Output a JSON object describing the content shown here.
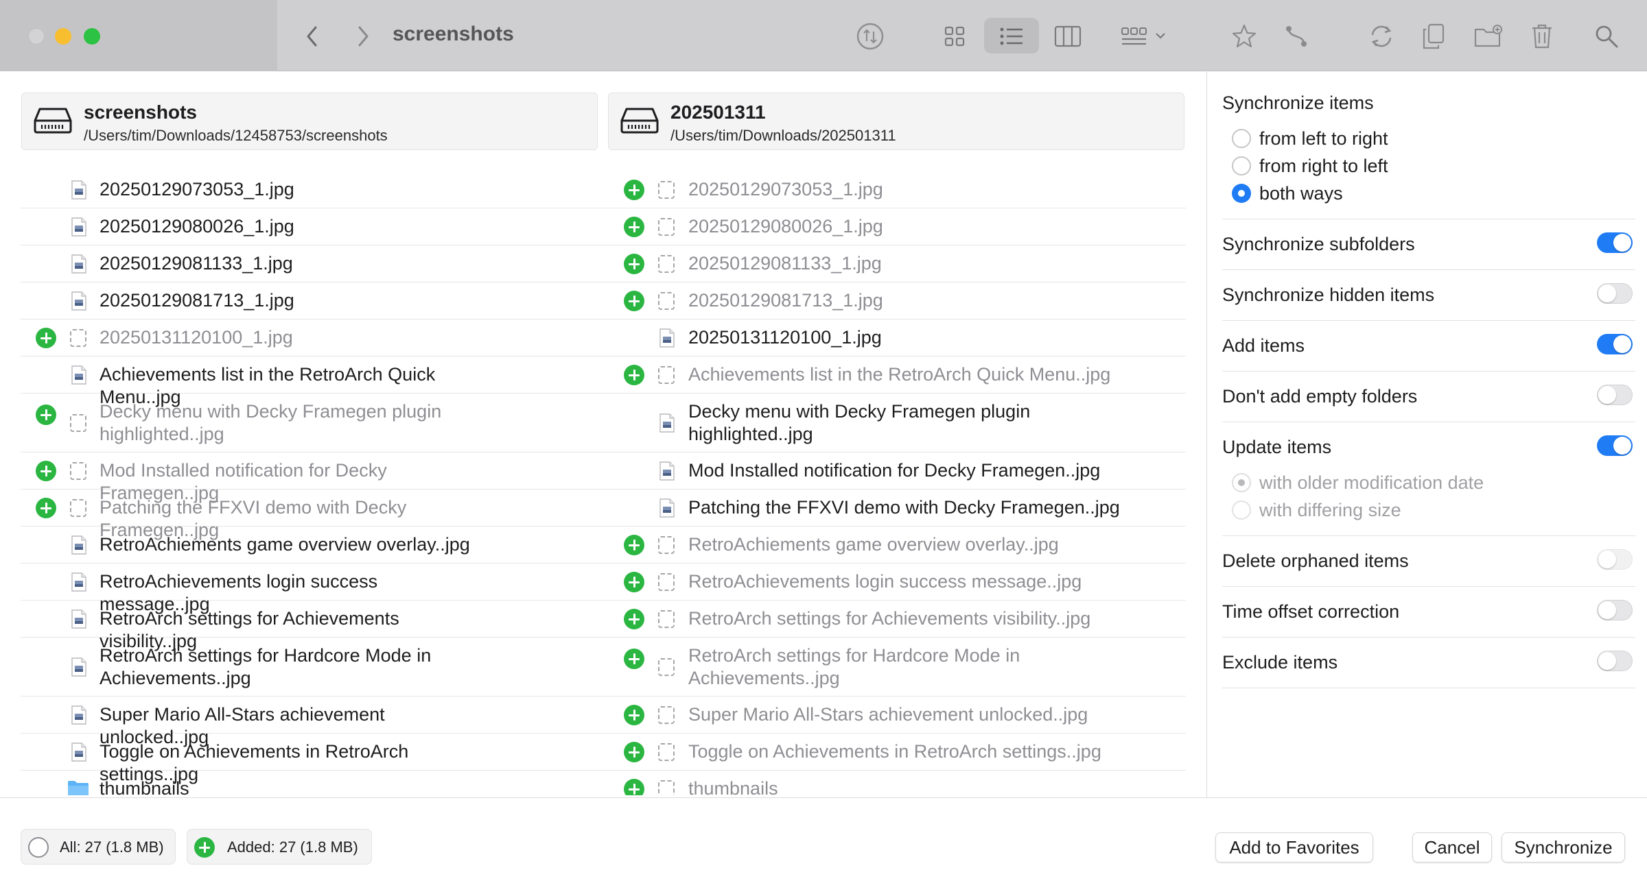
{
  "window": {
    "title": "screenshots",
    "toolbar_icons": [
      "back-icon",
      "forward-icon",
      "share-icon",
      "grid-view-icon",
      "list-view-icon",
      "column-view-icon",
      "group-by-icon",
      "star-icon",
      "connect-icon",
      "sync-icon",
      "copy-icon",
      "new-folder-icon",
      "trash-icon",
      "search-icon"
    ]
  },
  "left_panel": {
    "name": "screenshots",
    "path": "/Users/tim/Downloads/12458753/screenshots"
  },
  "right_panel": {
    "name": "202501311",
    "path": "/Users/tim/Downloads/202501311"
  },
  "files": [
    {
      "left": "20250129073053_1.jpg",
      "right": "20250129073053_1.jpg",
      "missing": "right",
      "type": "file"
    },
    {
      "left": "20250129080026_1.jpg",
      "right": "20250129080026_1.jpg",
      "missing": "right",
      "type": "file"
    },
    {
      "left": "20250129081133_1.jpg",
      "right": "20250129081133_1.jpg",
      "missing": "right",
      "type": "file"
    },
    {
      "left": "20250129081713_1.jpg",
      "right": "20250129081713_1.jpg",
      "missing": "right",
      "type": "file"
    },
    {
      "left": "20250131120100_1.jpg",
      "right": "20250131120100_1.jpg",
      "missing": "left",
      "type": "file"
    },
    {
      "left": "Achievements list in the RetroArch Quick Menu..jpg",
      "right": "Achievements list in the RetroArch Quick Menu..jpg",
      "missing": "right",
      "type": "file"
    },
    {
      "left": "Decky menu with Decky Framegen plugin highlighted..jpg",
      "right": "Decky menu with Decky Framegen plugin highlighted..jpg",
      "missing": "left",
      "type": "file"
    },
    {
      "left": "Mod Installed notification for Decky Framegen..jpg",
      "right": "Mod Installed notification for Decky Framegen..jpg",
      "missing": "left",
      "type": "file"
    },
    {
      "left": "Patching the FFXVI demo with Decky Framegen..jpg",
      "right": "Patching the FFXVI demo with Decky Framegen..jpg",
      "missing": "left",
      "type": "file"
    },
    {
      "left": "RetroAchiements game overview overlay..jpg",
      "right": "RetroAchiements game overview overlay..jpg",
      "missing": "right",
      "type": "file"
    },
    {
      "left": "RetroAchievements login success message..jpg",
      "right": "RetroAchievements login success message..jpg",
      "missing": "right",
      "type": "file"
    },
    {
      "left": "RetroArch settings for Achievements visibility..jpg",
      "right": "RetroArch settings for Achievements visibility..jpg",
      "missing": "right",
      "type": "file"
    },
    {
      "left": "RetroArch settings for Hardcore Mode in Achievements..jpg",
      "right": "RetroArch settings for Hardcore Mode in Achievements..jpg",
      "missing": "right",
      "type": "file"
    },
    {
      "left": "Super Mario All-Stars achievement unlocked..jpg",
      "right": "Super Mario All-Stars achievement unlocked..jpg",
      "missing": "right",
      "type": "file"
    },
    {
      "left": "Toggle on Achievements in RetroArch settings..jpg",
      "right": "Toggle on Achievements in RetroArch settings..jpg",
      "missing": "right",
      "type": "file"
    },
    {
      "left": "thumbnails",
      "right": "thumbnails",
      "missing": "right",
      "type": "folder"
    }
  ],
  "sidebar": {
    "direction_label": "Synchronize items",
    "direction_options": [
      "from left to right",
      "from right to left",
      "both ways"
    ],
    "direction_selected": "both ways",
    "options": {
      "subfolders": {
        "label": "Synchronize subfolders",
        "on": true
      },
      "hidden": {
        "label": "Synchronize hidden items",
        "on": false
      },
      "add": {
        "label": "Add items",
        "on": true
      },
      "empty_folders": {
        "label": "Don't add empty folders",
        "on": false
      },
      "update": {
        "label": "Update items",
        "on": true
      },
      "delete": {
        "label": "Delete orphaned items",
        "on": false
      },
      "time_offset": {
        "label": "Time offset correction",
        "on": false
      },
      "exclude": {
        "label": "Exclude items",
        "on": false
      }
    },
    "update_options": [
      "with older modification date",
      "with differing size"
    ],
    "update_selected": "with older modification date"
  },
  "footer": {
    "all_label": "All: 27 (1.8 MB)",
    "added_label": "Added: 27 (1.8 MB)",
    "favorites_button": "Add to Favorites",
    "cancel_button": "Cancel",
    "sync_button": "Synchronize"
  },
  "colors": {
    "accent": "#1f7cf5",
    "added": "#2bb642",
    "ghost_text": "#8e8e93"
  }
}
